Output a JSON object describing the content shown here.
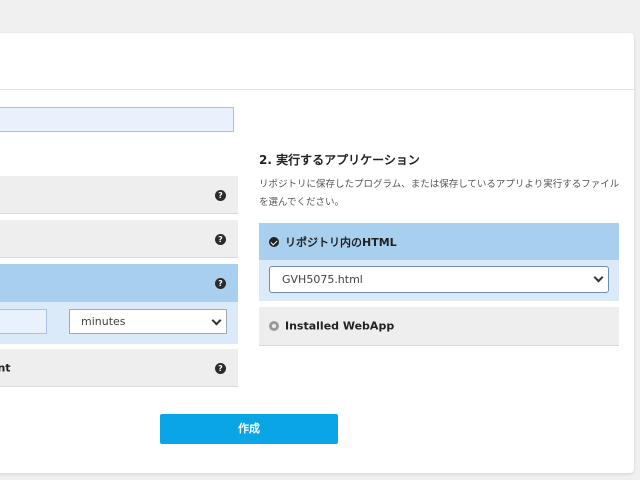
{
  "left_options": {
    "help_glyph": "?",
    "timeout_unit": "minutes",
    "environment_label_partial": "ent"
  },
  "actions": {
    "create_label": "作成"
  },
  "app_section": {
    "title": "2. 実行するアプリケーション",
    "description": "リポジトリに保存したプログラム、または保存しているアプリより実行するファイルを選んでください。",
    "options": [
      {
        "label": "リポジトリ内のHTML",
        "selected": true
      },
      {
        "label": "Installed WebApp",
        "selected": false
      }
    ],
    "file_value": "GVH5075.html"
  },
  "colors": {
    "accent": "#0aa5e5",
    "selected_row": "#a9cfef",
    "selected_panel": "#dbeaf8"
  }
}
